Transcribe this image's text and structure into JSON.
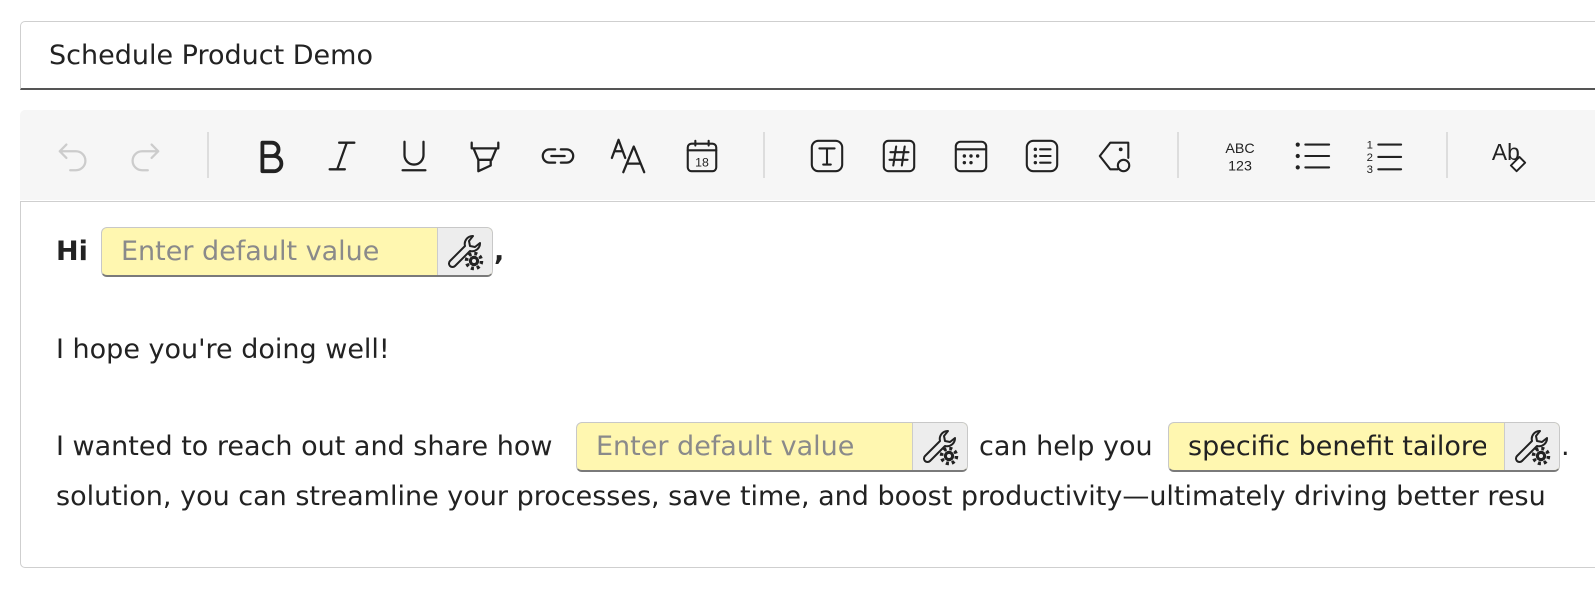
{
  "subject": {
    "value": "Schedule Product Demo"
  },
  "toolbar": {
    "buttons": [
      {
        "name": "undo",
        "title": "Undo"
      },
      {
        "name": "redo",
        "title": "Redo"
      },
      {
        "name": "bold",
        "title": "Bold"
      },
      {
        "name": "italic",
        "title": "Italic"
      },
      {
        "name": "underline",
        "title": "Underline"
      },
      {
        "name": "highlight",
        "title": "Highlight"
      },
      {
        "name": "link",
        "title": "Link"
      },
      {
        "name": "font-size",
        "title": "Font size"
      },
      {
        "name": "date",
        "title": "Insert date",
        "label": "18"
      },
      {
        "name": "text-variable",
        "title": "Text field"
      },
      {
        "name": "number-variable",
        "title": "Number field"
      },
      {
        "name": "date-variable",
        "title": "Date field"
      },
      {
        "name": "list-variable",
        "title": "List field"
      },
      {
        "name": "tag",
        "title": "Tag"
      },
      {
        "name": "text-case",
        "title": "Text case",
        "label_top": "ABC",
        "label_bottom": "123"
      },
      {
        "name": "bullet-list",
        "title": "Bulleted list"
      },
      {
        "name": "numbered-list",
        "title": "Numbered list",
        "numbers": [
          "1",
          "2",
          "3"
        ]
      },
      {
        "name": "clear-format",
        "title": "Clear formatting",
        "label": "Ab"
      }
    ]
  },
  "body": {
    "greeting": {
      "prefix": "Hi",
      "suffix": ","
    },
    "greeting_field": {
      "value": "",
      "placeholder": "Enter default value",
      "settings_icon": "wrench-gear-icon"
    },
    "line2": "I hope you're doing well!",
    "line3": {
      "part1": "I wanted to reach out and share how",
      "part2": "can help you",
      "part3": "."
    },
    "product_field": {
      "value": "",
      "placeholder": "Enter default value",
      "settings_icon": "wrench-gear-icon"
    },
    "benefit_field": {
      "value": "specific benefit tailored",
      "placeholder": "Enter default value",
      "settings_icon": "wrench-gear-icon"
    },
    "line4": "solution, you can streamline your processes, save time, and boost productivity—ultimately driving better resu"
  },
  "colors": {
    "field_background": "#fff7b0",
    "toolbar_background": "#f6f6f6",
    "placeholder_text": "#8a8a8a",
    "text": "#222222"
  }
}
